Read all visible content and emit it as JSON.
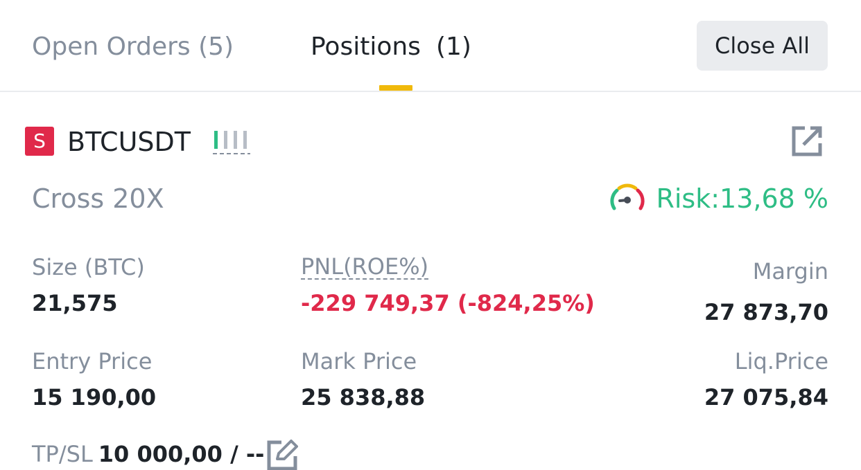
{
  "tabs": {
    "open_orders": "Open Orders (5)",
    "positions_label": "Positions",
    "positions_count": "(1)",
    "close_all": "Close All"
  },
  "position": {
    "side": "S",
    "symbol": "BTCUSDT",
    "margin_mode": "Cross 20X",
    "risk_text": "Risk:13,68 %",
    "size_label": "Size (BTC)",
    "size_value": "21,575",
    "pnl_label": "PNL(ROE%)",
    "pnl_value": "-229 749,37 (-824,25%)",
    "margin_label": "Margin",
    "margin_value": "27 873,70",
    "entry_label": "Entry Price",
    "entry_value": "15 190,00",
    "mark_label": "Mark Price",
    "mark_value": "25 838,88",
    "liq_label": "Liq.Price",
    "liq_value": "27 075,84",
    "tpsl_label": "TP/SL",
    "tpsl_value": "10 000,00 / --"
  },
  "icons": {
    "signal": "signal-bars-icon",
    "share": "share-icon",
    "risk": "risk-gauge-icon",
    "edit": "edit-icon"
  },
  "colors": {
    "accent": "#f0b90b",
    "sell": "#e0294a",
    "buy": "#2ebd85",
    "muted": "#848e9c",
    "text": "#1e2329"
  }
}
